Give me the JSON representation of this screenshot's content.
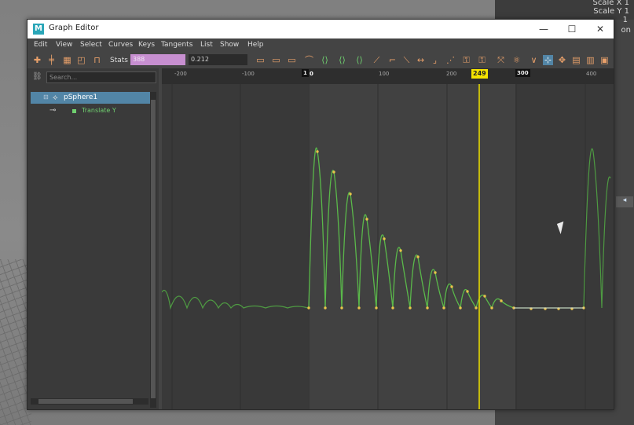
{
  "window": {
    "title": "Graph Editor",
    "app_icon": "M",
    "controls": {
      "minimize": "—",
      "maximize": "☐",
      "close": "✕"
    }
  },
  "menu": [
    "Edit",
    "View",
    "Select",
    "Curves",
    "Keys",
    "Tangents",
    "List",
    "Show",
    "Help"
  ],
  "toolbar": {
    "stats_label": "Stats",
    "stats_value": "388",
    "value_field": "0.212"
  },
  "outliner": {
    "search_placeholder": "Search...",
    "items": [
      {
        "label": "pSphere1",
        "selected": true
      },
      {
        "label": "Translate Y",
        "selected": false
      }
    ]
  },
  "graph": {
    "ruler_ticks": [
      "-200",
      "-100",
      "0",
      "100",
      "200",
      "300",
      "400"
    ],
    "frame_start": "1",
    "frame_end": "300",
    "current_frame": "249",
    "curve_color": "#5ab84a",
    "key_color": "#e8c44a",
    "current_time_color": "#f5e300"
  },
  "right_panel": {
    "attrs": [
      "Scale X",
      "Scale Y",
      "on"
    ],
    "values": [
      "1",
      "1",
      "1"
    ]
  },
  "colors": {
    "selection": "#5285a6",
    "stats_field": "#c78fd0",
    "window_bg": "#444444",
    "graph_bg": "#393939"
  }
}
